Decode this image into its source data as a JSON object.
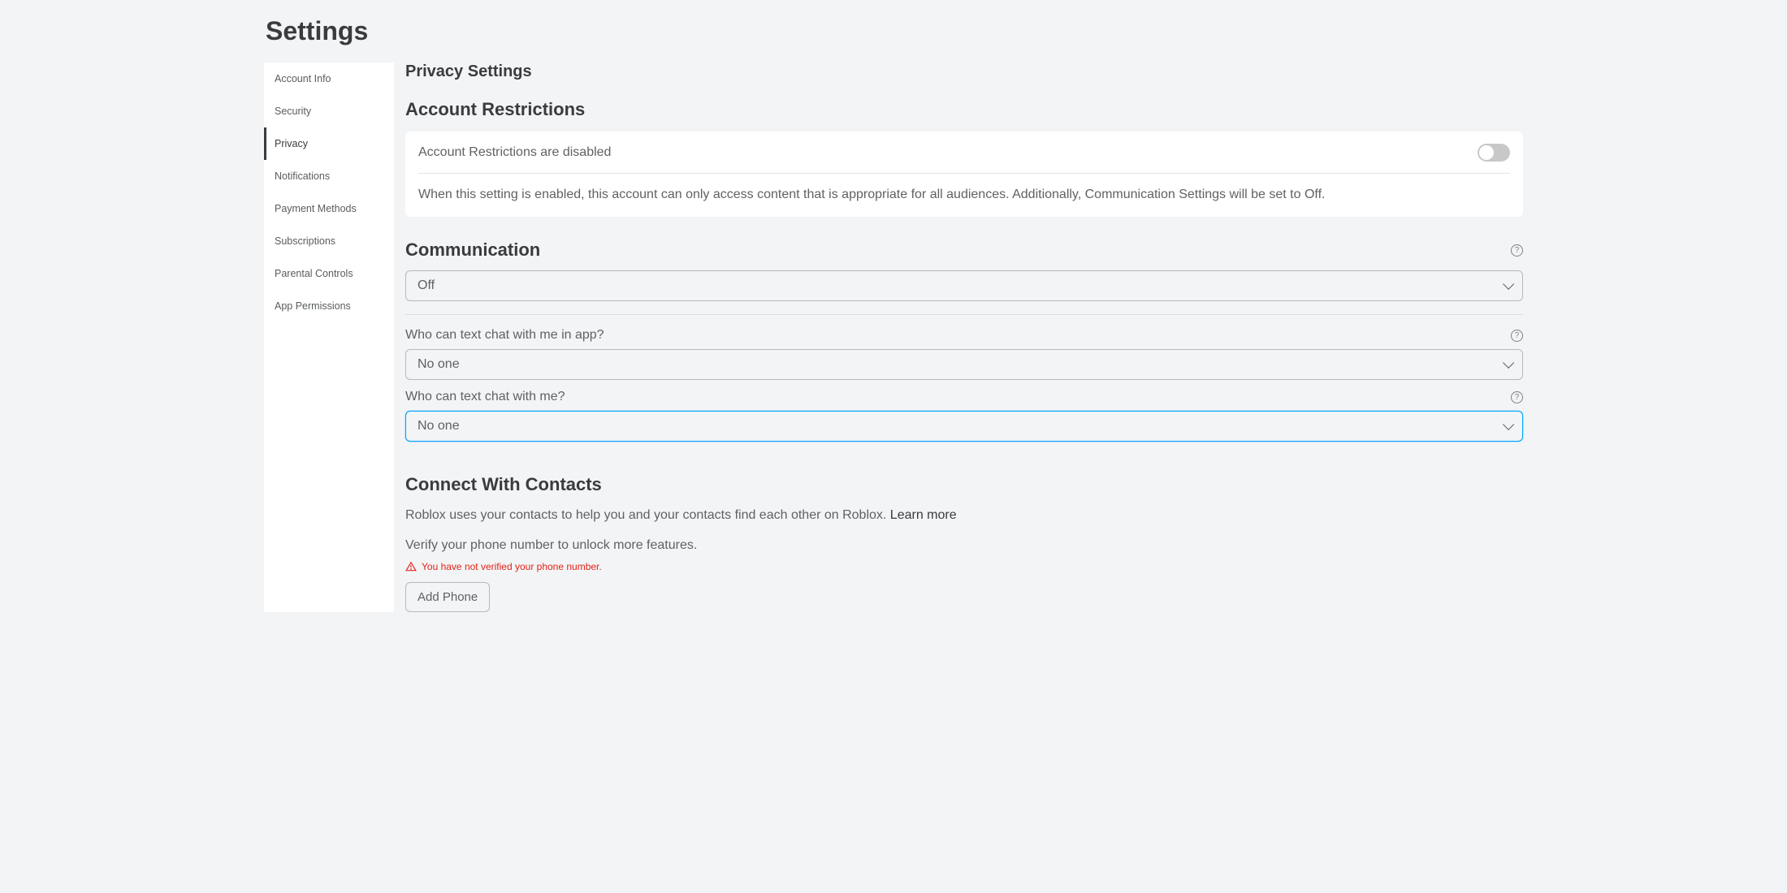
{
  "page": {
    "title": "Settings"
  },
  "sidebar": {
    "items": [
      {
        "label": "Account Info",
        "active": false
      },
      {
        "label": "Security",
        "active": false
      },
      {
        "label": "Privacy",
        "active": true
      },
      {
        "label": "Notifications",
        "active": false
      },
      {
        "label": "Payment Methods",
        "active": false
      },
      {
        "label": "Subscriptions",
        "active": false
      },
      {
        "label": "Parental Controls",
        "active": false
      },
      {
        "label": "App Permissions",
        "active": false
      }
    ]
  },
  "content": {
    "heading": "Privacy Settings",
    "account_restrictions": {
      "title": "Account Restrictions",
      "toggle_label": "Account Restrictions are disabled",
      "toggle_on": false,
      "description": "When this setting is enabled, this account can only access content that is appropriate for all audiences. Additionally, Communication Settings will be set to Off."
    },
    "communication": {
      "title": "Communication",
      "main_select_value": "Off",
      "q1_label": "Who can text chat with me in app?",
      "q1_value": "No one",
      "q2_label": "Who can text chat with me?",
      "q2_value": "No one"
    },
    "contacts": {
      "title": "Connect With Contacts",
      "description": "Roblox uses your contacts to help you and your contacts find each other on Roblox. ",
      "learn_more": "Learn more",
      "verify_text": "Verify your phone number to unlock more features.",
      "warning_text": "You have not verified your phone number.",
      "add_phone_label": "Add Phone"
    },
    "help_tooltip": "?"
  }
}
